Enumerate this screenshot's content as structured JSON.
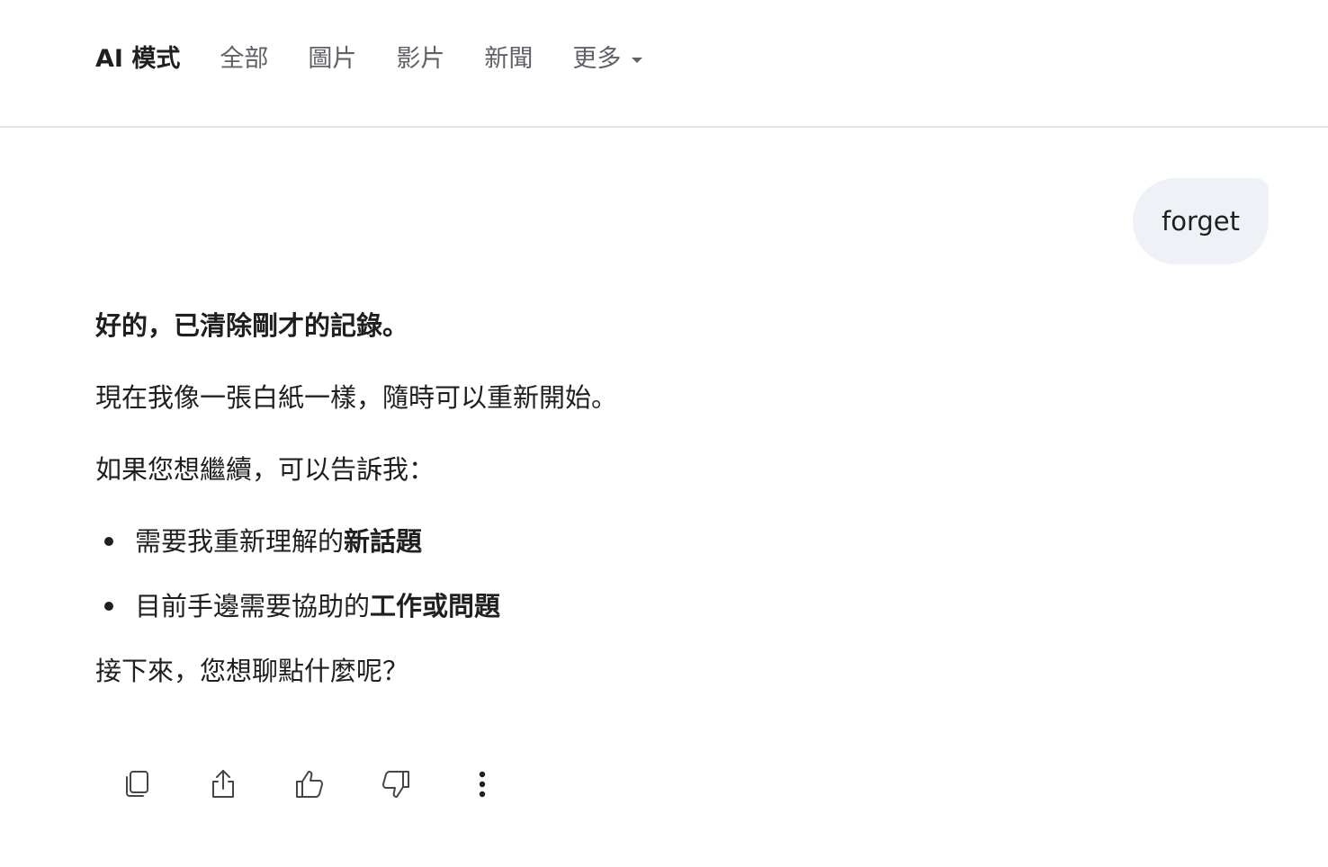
{
  "nav": {
    "tabs": [
      {
        "label": "AI 模式",
        "active": true
      },
      {
        "label": "全部",
        "active": false
      },
      {
        "label": "圖片",
        "active": false
      },
      {
        "label": "影片",
        "active": false
      },
      {
        "label": "新聞",
        "active": false
      },
      {
        "label": "更多",
        "active": false
      }
    ]
  },
  "query": {
    "text": "forget"
  },
  "response": {
    "lead": "好的，已清除剛才的記錄。",
    "para1": "現在我像一張白紙一樣，隨時可以重新開始。",
    "para2": "如果您想繼續，可以告訴我：",
    "bullets": [
      {
        "prefix": "需要我重新理解的",
        "bold": "新話題"
      },
      {
        "prefix": "目前手邊需要協助的",
        "bold": "工作或問題"
      }
    ],
    "closing": "接下來，您想聊點什麼呢？"
  },
  "actions": {
    "icons": [
      "copy-icon",
      "share-icon",
      "thumbs-up-icon",
      "thumbs-down-icon",
      "more-vert-icon"
    ]
  }
}
